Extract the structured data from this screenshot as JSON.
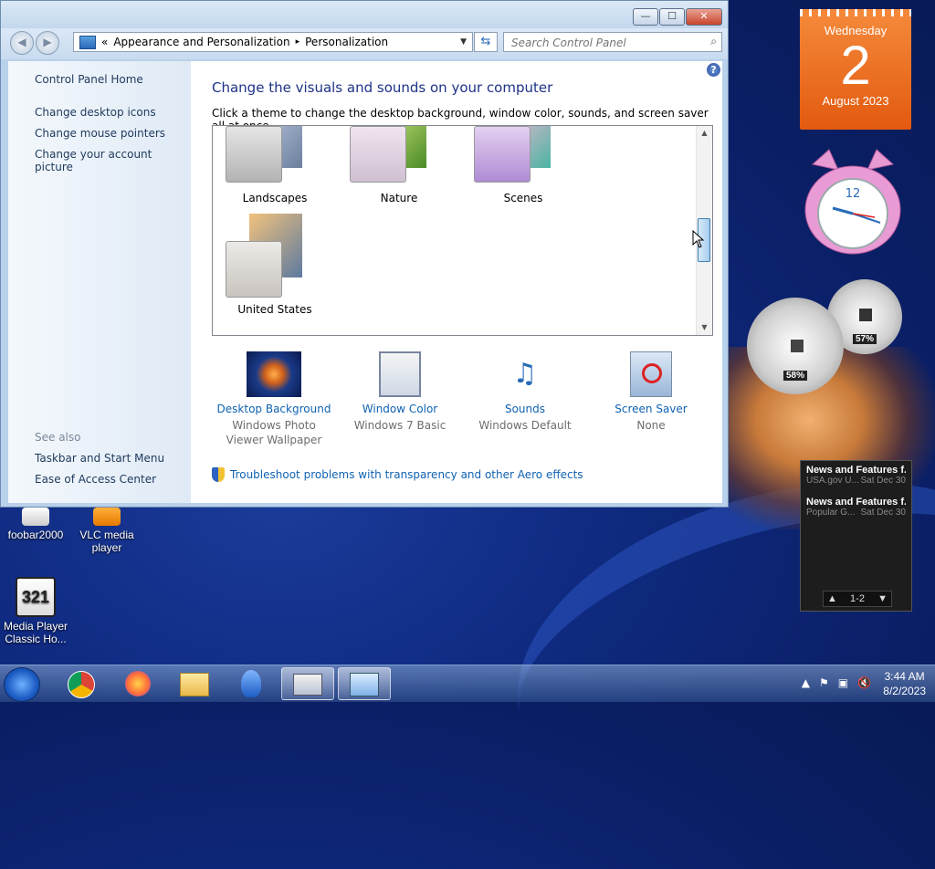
{
  "window": {
    "breadcrumb": [
      "Appearance and Personalization",
      "Personalization"
    ],
    "breadcrumb_prefix": "«",
    "breadcrumb_sep": "▸",
    "search_placeholder": "Search Control Panel",
    "controls": {
      "minimize": "—",
      "maximize": "☐",
      "close": "✕"
    }
  },
  "sidebar": {
    "home": "Control Panel Home",
    "links": [
      "Change desktop icons",
      "Change mouse pointers",
      "Change your account picture"
    ],
    "see_also_label": "See also",
    "see_also": [
      "Taskbar and Start Menu",
      "Ease of Access Center"
    ]
  },
  "main": {
    "title": "Change the visuals and sounds on your computer",
    "subtitle": "Click a theme to change the desktop background, window color, sounds, and screen saver all at once.",
    "help_icon": "?",
    "themes": [
      {
        "name": "Landscapes",
        "color": "#9aa9c4"
      },
      {
        "name": "Nature",
        "color": "#7fb047"
      },
      {
        "name": "Scenes",
        "color": "#a07bc7"
      },
      {
        "name": "United States",
        "color": "#b68552"
      }
    ],
    "scroll_position": 0.5,
    "tools": [
      {
        "label": "Desktop Background",
        "sub": "Windows Photo Viewer Wallpaper",
        "icon": "jellyfish-wallpaper-icon"
      },
      {
        "label": "Window Color",
        "sub": "Windows 7 Basic",
        "icon": "window-color-icon"
      },
      {
        "label": "Sounds",
        "sub": "Windows Default",
        "icon": "music-notes-icon"
      },
      {
        "label": "Screen Saver",
        "sub": "None",
        "icon": "screen-saver-icon"
      }
    ],
    "troubleshoot": "Troubleshoot problems with transparency and other Aero effects"
  },
  "desktop_icons": [
    {
      "label": "foobar2000"
    },
    {
      "label": "VLC media player"
    },
    {
      "label": "Media Player Classic Ho..."
    }
  ],
  "gadgets": {
    "calendar": {
      "weekday": "Wednesday",
      "day": "2",
      "month": "August 2023"
    },
    "clock": {
      "numeral": "12"
    },
    "cpu_meter": {
      "cpu": "58%",
      "memory": "57%"
    },
    "feeds": {
      "items": [
        {
          "title": "News and Features f...",
          "source": "USA.gov U...",
          "date": "Sat Dec 30"
        },
        {
          "title": "News and Features f...",
          "source": "Popular G...",
          "date": "Sat Dec 30"
        }
      ],
      "pager": "1-2"
    }
  },
  "taskbar": {
    "time": "3:44 AM",
    "date": "8/2/2023",
    "apps": [
      "chrome",
      "firefox",
      "explorer",
      "app",
      "keyboard",
      "control-panel"
    ],
    "accent": "#2a6cb8"
  }
}
